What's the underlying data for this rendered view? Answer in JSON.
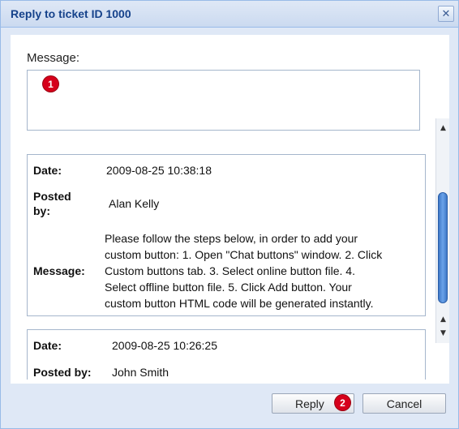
{
  "dialog": {
    "title": "Reply to ticket ID 1000",
    "close_glyph": "✕"
  },
  "form": {
    "message_label": "Message:",
    "message_value": ""
  },
  "badges": [
    "1",
    "2"
  ],
  "history": [
    {
      "date_label": "Date:",
      "date": "2009-08-25 10:38:18",
      "posted_by_label_line1": "Posted",
      "posted_by_label_line2": "by:",
      "posted_by": "Alan Kelly",
      "message_label": "Message:",
      "message_lines": [
        "Please follow the steps below, in order to add your",
        "custom button: 1. Open \"Chat buttons\" window. 2. Click",
        "Custom buttons tab. 3. Select online button file. 4.",
        "Select offline button file. 5. Click Add button. Your",
        "custom button HTML code will be generated instantly."
      ]
    },
    {
      "date_label": "Date:",
      "date": "2009-08-25 10:26:25",
      "posted_by_label": "Posted by:",
      "posted_by": "John Smith"
    }
  ],
  "scrollbar": {
    "up_glyph": "▲",
    "down_glyph": "▼"
  },
  "buttons": {
    "reply_label": "Reply",
    "cancel_label": "Cancel"
  },
  "colors": {
    "title_text": "#15428b",
    "dialog_bg": "#dfe8f6",
    "badge": "#d6001b"
  }
}
